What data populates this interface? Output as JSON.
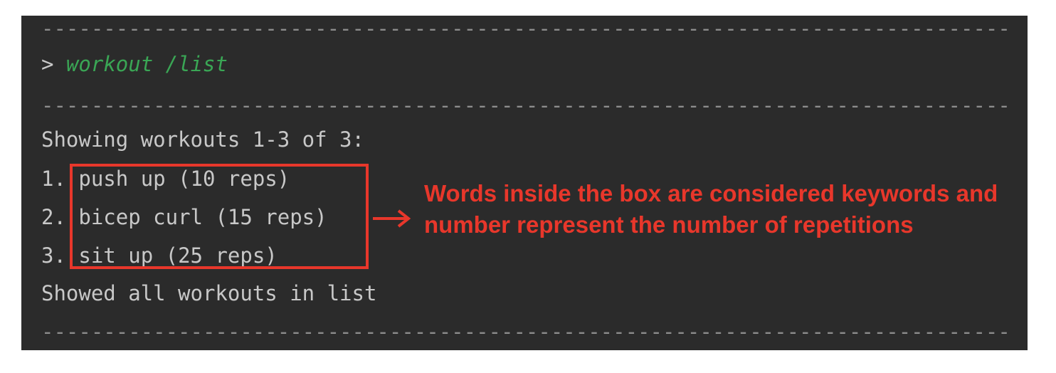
{
  "terminal": {
    "divider": "--------------------------------------------------------------------------------------------------------------------------------------------",
    "prompt_symbol": ">",
    "command": "workout /list",
    "header": "Showing workouts 1-3 of 3:",
    "items": [
      {
        "number": "1.",
        "text": "push up (10 reps)"
      },
      {
        "number": "2.",
        "text": "bicep curl (15 reps)"
      },
      {
        "number": "3.",
        "text": "sit up (25 reps)"
      }
    ],
    "footer": "Showed all workouts in list"
  },
  "annotation": {
    "text": "Words inside the box are considered keywords and number represent the number of repetitions",
    "color": "#e8372b"
  },
  "colors": {
    "terminal_bg": "#2b2b2b",
    "text": "#c8c8c8",
    "command": "#3aa655",
    "highlight": "#e8372b"
  }
}
